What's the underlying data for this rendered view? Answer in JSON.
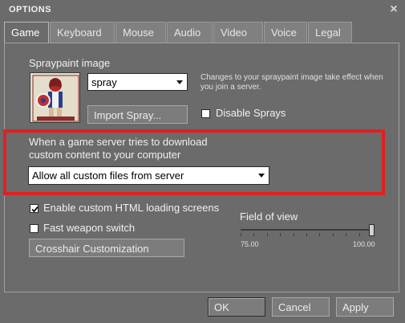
{
  "window": {
    "title": "OPTIONS",
    "close_glyph": "×"
  },
  "tabs": [
    {
      "label": "Game",
      "active": true
    },
    {
      "label": "Keyboard",
      "active": false
    },
    {
      "label": "Mouse",
      "active": false
    },
    {
      "label": "Audio",
      "active": false
    },
    {
      "label": "Video",
      "active": false
    },
    {
      "label": "Voice",
      "active": false
    },
    {
      "label": "Legal",
      "active": false
    }
  ],
  "spray": {
    "heading": "Spraypaint image",
    "selected": "spray",
    "note": "Changes to your spraypaint image take effect when you join a server.",
    "import_label": "Import Spray...",
    "disable_label": "Disable Sprays",
    "disable_checked": false
  },
  "custom_content": {
    "prompt_line1": "When a game server tries to download",
    "prompt_line2": "custom content to your computer",
    "selected": "Allow all custom files from server"
  },
  "options": {
    "html_loading_label": "Enable custom HTML loading screens",
    "html_loading_checked": true,
    "fast_switch_label": "Fast weapon switch",
    "fast_switch_checked": false,
    "crosshair_label": "Crosshair Customization"
  },
  "fov": {
    "label": "Field of view",
    "min_label": "75.00",
    "max_label": "100.00",
    "value": 100
  },
  "footer": {
    "ok": "OK",
    "cancel": "Cancel",
    "apply": "Apply"
  },
  "colors": {
    "highlight": "#e02020",
    "window_bg": "#6b6b6b"
  }
}
